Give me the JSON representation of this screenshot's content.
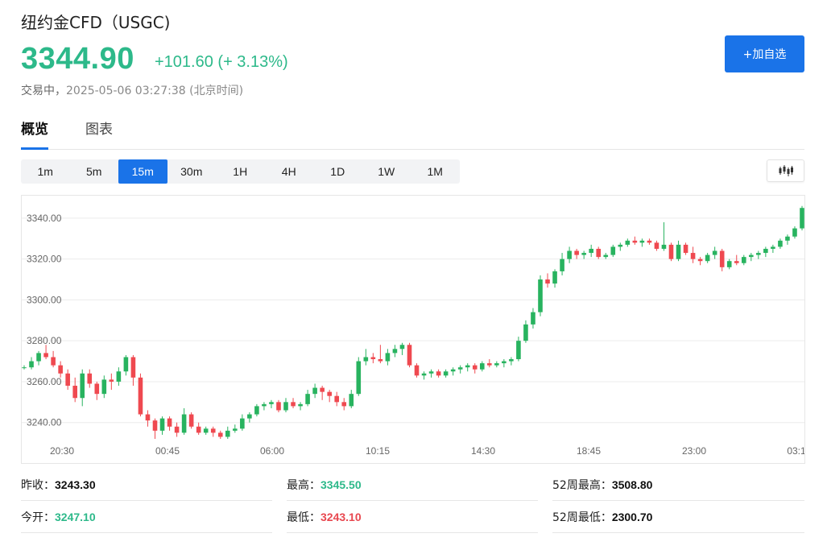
{
  "header": {
    "title": "纽约金CFD（USGC)",
    "price": "3344.90",
    "change": "+101.60 (+ 3.13%)",
    "status_label": "交易中，",
    "timestamp": "2025-05-06 03:27:38",
    "timezone": "(北京时间)",
    "add_watchlist_label": "+加自选"
  },
  "tabs": [
    {
      "label": "概览",
      "active": true
    },
    {
      "label": "图表",
      "active": false
    }
  ],
  "intervals": [
    {
      "label": "1m",
      "active": false
    },
    {
      "label": "5m",
      "active": false
    },
    {
      "label": "15m",
      "active": true
    },
    {
      "label": "30m",
      "active": false
    },
    {
      "label": "1H",
      "active": false
    },
    {
      "label": "4H",
      "active": false
    },
    {
      "label": "1D",
      "active": false
    },
    {
      "label": "1W",
      "active": false
    },
    {
      "label": "1M",
      "active": false
    }
  ],
  "chart_type_icon": "candlestick-icon",
  "colors": {
    "up": "#2db98a",
    "candle_up": "#28b35f",
    "candle_down": "#ef4950",
    "accent": "#1a73e8"
  },
  "chart_data": {
    "type": "candlestick",
    "title": "",
    "xlabel": "",
    "ylabel": "",
    "ylim": [
      3232,
      3351
    ],
    "y_ticks": [
      "3340.00",
      "3320.00",
      "3300.00",
      "3280.00",
      "3260.00",
      "3240.00"
    ],
    "y_tick_values": [
      3340,
      3320,
      3300,
      3280,
      3260,
      3240
    ],
    "x_ticks": [
      "20:30",
      "00:45",
      "06:00",
      "10:15",
      "14:30",
      "18:45",
      "23:00",
      "03:1"
    ],
    "grid": true,
    "candles": [
      [
        3267,
        3268,
        3266,
        3267
      ],
      [
        3267,
        3272,
        3266,
        3270
      ],
      [
        3270,
        3275,
        3268,
        3274
      ],
      [
        3274,
        3278,
        3271,
        3272
      ],
      [
        3272,
        3275,
        3267,
        3268
      ],
      [
        3268,
        3270,
        3262,
        3264
      ],
      [
        3264,
        3266,
        3256,
        3258
      ],
      [
        3258,
        3262,
        3250,
        3252
      ],
      [
        3252,
        3266,
        3248,
        3264
      ],
      [
        3264,
        3266,
        3257,
        3259
      ],
      [
        3259,
        3260,
        3251,
        3254
      ],
      [
        3254,
        3263,
        3252,
        3261
      ],
      [
        3261,
        3264,
        3256,
        3260
      ],
      [
        3260,
        3267,
        3258,
        3265
      ],
      [
        3265,
        3273,
        3263,
        3272
      ],
      [
        3272,
        3273,
        3258,
        3262
      ],
      [
        3262,
        3264,
        3243,
        3244
      ],
      [
        3244,
        3246,
        3238,
        3241
      ],
      [
        3241,
        3242,
        3232,
        3236
      ],
      [
        3236,
        3243,
        3234,
        3242
      ],
      [
        3242,
        3243,
        3236,
        3238
      ],
      [
        3238,
        3240,
        3233,
        3235
      ],
      [
        3235,
        3247,
        3234,
        3244
      ],
      [
        3244,
        3245,
        3237,
        3238
      ],
      [
        3238,
        3240,
        3234,
        3235
      ],
      [
        3235,
        3238,
        3234,
        3237
      ],
      [
        3237,
        3238,
        3233,
        3235
      ],
      [
        3235,
        3236,
        3232,
        3233
      ],
      [
        3233,
        3238,
        3232,
        3236
      ],
      [
        3236,
        3239,
        3235,
        3237
      ],
      [
        3237,
        3244,
        3236,
        3242
      ],
      [
        3242,
        3245,
        3240,
        3244
      ],
      [
        3244,
        3249,
        3243,
        3248
      ],
      [
        3248,
        3250,
        3246,
        3249
      ],
      [
        3249,
        3251,
        3247,
        3250
      ],
      [
        3250,
        3251,
        3245,
        3246
      ],
      [
        3246,
        3252,
        3245,
        3250
      ],
      [
        3250,
        3252,
        3247,
        3248
      ],
      [
        3248,
        3250,
        3246,
        3249
      ],
      [
        3249,
        3256,
        3248,
        3254
      ],
      [
        3254,
        3259,
        3252,
        3257
      ],
      [
        3257,
        3258,
        3251,
        3255
      ],
      [
        3255,
        3256,
        3250,
        3253
      ],
      [
        3253,
        3255,
        3248,
        3250
      ],
      [
        3250,
        3252,
        3246,
        3248
      ],
      [
        3248,
        3256,
        3247,
        3254
      ],
      [
        3254,
        3272,
        3253,
        3270
      ],
      [
        3270,
        3276,
        3268,
        3272
      ],
      [
        3272,
        3274,
        3269,
        3271
      ],
      [
        3271,
        3278,
        3269,
        3270
      ],
      [
        3270,
        3276,
        3268,
        3274
      ],
      [
        3274,
        3278,
        3272,
        3276
      ],
      [
        3276,
        3279,
        3273,
        3278
      ],
      [
        3278,
        3279,
        3267,
        3268
      ],
      [
        3268,
        3269,
        3262,
        3263
      ],
      [
        3263,
        3265,
        3261,
        3264
      ],
      [
        3264,
        3266,
        3262,
        3265
      ],
      [
        3265,
        3266,
        3262,
        3263
      ],
      [
        3263,
        3266,
        3262,
        3265
      ],
      [
        3265,
        3267,
        3263,
        3266
      ],
      [
        3266,
        3268,
        3264,
        3267
      ],
      [
        3267,
        3269,
        3265,
        3268
      ],
      [
        3268,
        3269,
        3264,
        3266
      ],
      [
        3266,
        3270,
        3265,
        3269
      ],
      [
        3269,
        3271,
        3267,
        3268
      ],
      [
        3268,
        3270,
        3267,
        3269
      ],
      [
        3269,
        3271,
        3267,
        3270
      ],
      [
        3270,
        3272,
        3268,
        3271
      ],
      [
        3271,
        3282,
        3270,
        3280
      ],
      [
        3280,
        3290,
        3279,
        3288
      ],
      [
        3288,
        3296,
        3286,
        3294
      ],
      [
        3294,
        3312,
        3292,
        3310
      ],
      [
        3310,
        3313,
        3306,
        3308
      ],
      [
        3308,
        3315,
        3306,
        3314
      ],
      [
        3314,
        3323,
        3312,
        3320
      ],
      [
        3320,
        3326,
        3318,
        3324
      ],
      [
        3324,
        3325,
        3320,
        3322
      ],
      [
        3322,
        3324,
        3320,
        3323
      ],
      [
        3323,
        3327,
        3321,
        3325
      ],
      [
        3325,
        3326,
        3320,
        3321
      ],
      [
        3321,
        3323,
        3320,
        3322
      ],
      [
        3322,
        3327,
        3321,
        3326
      ],
      [
        3326,
        3328,
        3324,
        3327
      ],
      [
        3327,
        3330,
        3326,
        3329
      ],
      [
        3329,
        3331,
        3327,
        3328
      ],
      [
        3328,
        3330,
        3326,
        3329
      ],
      [
        3329,
        3330,
        3327,
        3328
      ],
      [
        3328,
        3329,
        3324,
        3325
      ],
      [
        3325,
        3338,
        3324,
        3327
      ],
      [
        3327,
        3328,
        3319,
        3320
      ],
      [
        3320,
        3329,
        3319,
        3327
      ],
      [
        3327,
        3328,
        3322,
        3323
      ],
      [
        3323,
        3326,
        3318,
        3320
      ],
      [
        3320,
        3321,
        3317,
        3319
      ],
      [
        3319,
        3323,
        3318,
        3322
      ],
      [
        3322,
        3326,
        3320,
        3324
      ],
      [
        3324,
        3325,
        3314,
        3316
      ],
      [
        3316,
        3320,
        3315,
        3319
      ],
      [
        3319,
        3322,
        3317,
        3318
      ],
      [
        3318,
        3322,
        3317,
        3321
      ],
      [
        3321,
        3323,
        3319,
        3322
      ],
      [
        3322,
        3324,
        3320,
        3323
      ],
      [
        3323,
        3326,
        3321,
        3325
      ],
      [
        3325,
        3327,
        3323,
        3326
      ],
      [
        3326,
        3330,
        3325,
        3329
      ],
      [
        3329,
        3332,
        3327,
        3331
      ],
      [
        3331,
        3336,
        3330,
        3335
      ],
      [
        3335,
        3346,
        3334,
        3345
      ]
    ]
  },
  "stats": [
    {
      "label": "昨收：",
      "value": "3243.30",
      "color": "dark"
    },
    {
      "label": "最高：",
      "value": "3345.50",
      "color": "green"
    },
    {
      "label": "52周最高：",
      "value": "3508.80",
      "color": "dark"
    },
    {
      "label": "今开：",
      "value": "3247.10",
      "color": "green"
    },
    {
      "label": "最低：",
      "value": "3243.10",
      "color": "red"
    },
    {
      "label": "52周最低：",
      "value": "2300.70",
      "color": "dark"
    }
  ]
}
